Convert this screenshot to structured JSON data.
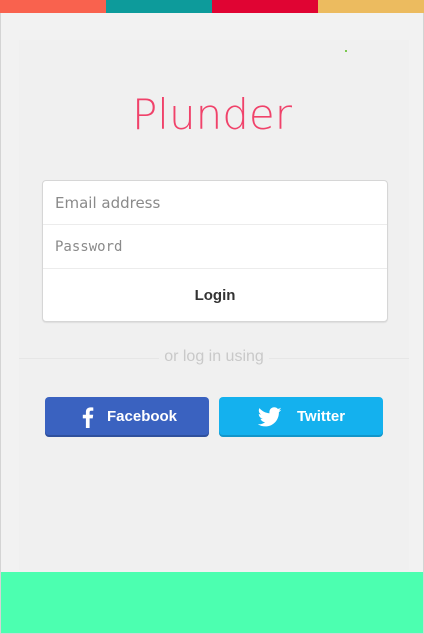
{
  "colors": {
    "stripes": [
      "#f9624e",
      "#0d9b9b",
      "#e00433",
      "#ecbb5f"
    ],
    "logo": "#f0426a",
    "facebook": "#3a62c0",
    "twitter": "#14b1ee",
    "bottom_band": "#4cffb0",
    "dot": "#7bc850"
  },
  "app": {
    "logo_text": "Plunder"
  },
  "login_form": {
    "email_placeholder": "Email address",
    "password_placeholder": "Password",
    "login_label": "Login"
  },
  "divider": {
    "text": "or log in using"
  },
  "social": {
    "facebook_label": "Facebook",
    "facebook_icon": "facebook-icon",
    "twitter_label": "Twitter",
    "twitter_icon": "twitter-icon"
  }
}
